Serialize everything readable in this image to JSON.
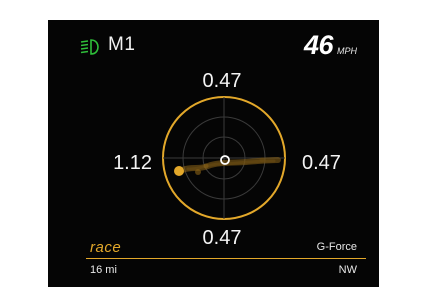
{
  "header": {
    "mode": "M1",
    "speed": "46",
    "speed_unit": "MPH"
  },
  "gforce": {
    "top": "0.47",
    "left": "1.12",
    "right": "0.47",
    "bottom": "0.47",
    "label": "G-Force"
  },
  "footer": {
    "drive_mode": "race",
    "odometer": "16 mi",
    "heading": "NW"
  },
  "colors": {
    "accent": "#e3a82a",
    "headlight": "#2fbf3a",
    "background": "#050505"
  },
  "icons": {
    "headlight": "headlight-icon"
  }
}
